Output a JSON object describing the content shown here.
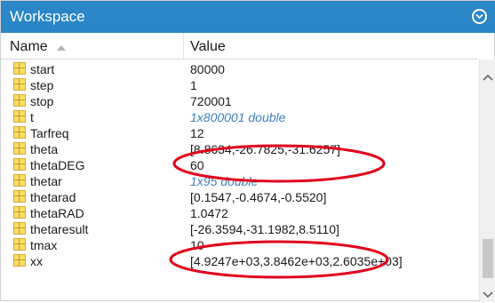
{
  "window": {
    "title": "Workspace",
    "menu_icon": "chevron-down-circle-icon"
  },
  "columns": {
    "name": "Name",
    "value": "Value",
    "sort_icon": "sort-ascending-icon"
  },
  "variables": [
    {
      "name": "start",
      "value": "80000",
      "italic": false
    },
    {
      "name": "step",
      "value": "1",
      "italic": false
    },
    {
      "name": "stop",
      "value": "720001",
      "italic": false
    },
    {
      "name": "t",
      "value": "1x800001 double",
      "italic": true
    },
    {
      "name": "Tarfreq",
      "value": "12",
      "italic": false
    },
    {
      "name": "theta",
      "value": "[8.8634,-26.7825,-31.6257]",
      "italic": false
    },
    {
      "name": "thetaDEG",
      "value": "60",
      "italic": false
    },
    {
      "name": "thetar",
      "value": "1x95 double",
      "italic": true
    },
    {
      "name": "thetarad",
      "value": "[0.1547,-0.4674,-0.5520]",
      "italic": false
    },
    {
      "name": "thetaRAD",
      "value": "1.0472",
      "italic": false
    },
    {
      "name": "thetaresult",
      "value": "[-26.3594,-31.1982,8.5110]",
      "italic": false
    },
    {
      "name": "tmax",
      "value": "10",
      "italic": false
    },
    {
      "name": "xx",
      "value": "[4.9247e+03,3.8462e+03,2.6035e+03]",
      "italic": false
    }
  ],
  "colors": {
    "title_bar": "#2a86c6",
    "link_value": "#3f7fbf",
    "annotation": "#e0001b"
  }
}
